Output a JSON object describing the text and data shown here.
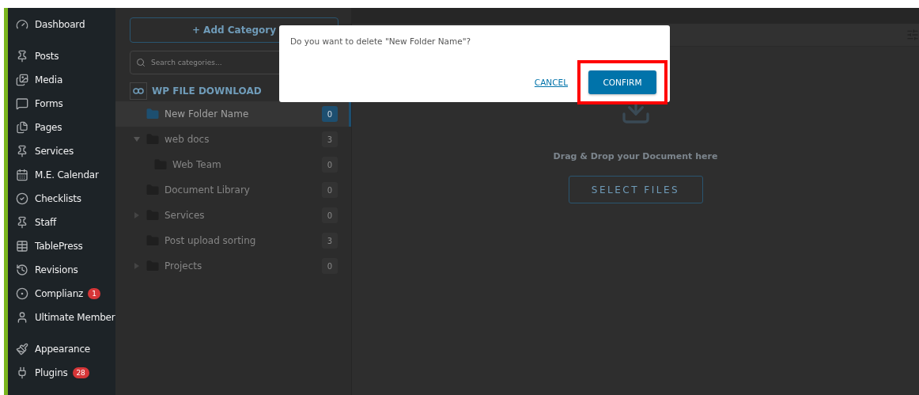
{
  "sidebar": {
    "groups": [
      [
        {
          "label": "Dashboard"
        }
      ],
      [
        {
          "label": "Posts"
        },
        {
          "label": "Media"
        },
        {
          "label": "Forms"
        },
        {
          "label": "Pages"
        },
        {
          "label": "Services"
        },
        {
          "label": "M.E. Calendar"
        },
        {
          "label": "Checklists"
        },
        {
          "label": "Staff"
        },
        {
          "label": "TablePress"
        },
        {
          "label": "Revisions"
        },
        {
          "label": "Complianz",
          "badge": "1"
        },
        {
          "label": "Ultimate Member"
        }
      ],
      [
        {
          "label": "Appearance"
        },
        {
          "label": "Plugins",
          "badge": "28"
        }
      ]
    ]
  },
  "categories": {
    "add_button": "+ Add Category",
    "search": {
      "placeholder": "Search categories..."
    },
    "root": "WP FILE DOWNLOAD",
    "tree": [
      {
        "label": "New Folder Name",
        "count": "0",
        "selected": true
      },
      {
        "label": "web docs",
        "count": "3",
        "selected": false,
        "expanded": true,
        "children": [
          {
            "label": "Web Team",
            "count": "0",
            "selected": false
          }
        ]
      },
      {
        "label": "Document Library",
        "count": "0",
        "selected": false
      },
      {
        "label": "Services",
        "count": "0",
        "selected": false,
        "expanded": false
      },
      {
        "label": "Post upload sorting",
        "count": "3",
        "selected": false
      },
      {
        "label": "Projects",
        "count": "0",
        "selected": false,
        "expanded": false
      }
    ]
  },
  "upload": {
    "hint": "Drag & Drop your Document here",
    "button": "SELECT FILES"
  },
  "dialog": {
    "message": "Do you want to delete \"New Folder Name\"?",
    "cancel": "CANCEL",
    "confirm": {
      "label": "CONFIRM",
      "highlighted": true
    }
  }
}
